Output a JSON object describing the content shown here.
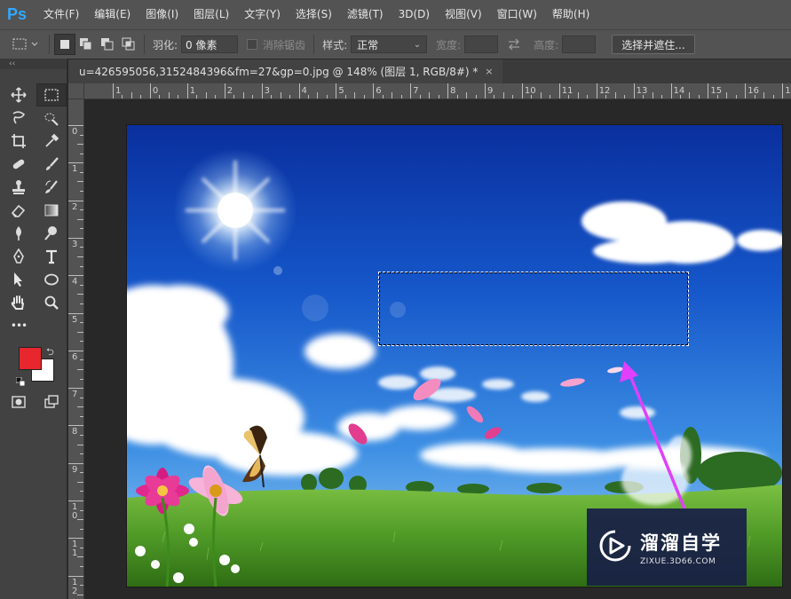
{
  "app": {
    "logo": "Ps"
  },
  "menu": [
    "文件(F)",
    "编辑(E)",
    "图像(I)",
    "图层(L)",
    "文字(Y)",
    "选择(S)",
    "滤镜(T)",
    "3D(D)",
    "视图(V)",
    "窗口(W)",
    "帮助(H)"
  ],
  "options": {
    "feather_label": "羽化:",
    "feather_value": "0 像素",
    "antialias_label": "消除锯齿",
    "style_label": "样式:",
    "style_value": "正常",
    "width_label": "宽度:",
    "height_label": "高度:",
    "select_mask_button": "选择并遮住..."
  },
  "toolbox": {
    "collapse": "‹‹",
    "more": "•••",
    "foreground_color": "#e8262e",
    "background_color": "#ffffff"
  },
  "document": {
    "tab_title": "u=426595056,3152484396&fm=27&gp=0.jpg @ 148% (图层 1, RGB/8#) *",
    "close": "×"
  },
  "rulers": {
    "horizontal": [
      "1",
      "0",
      "1",
      "2",
      "3",
      "4",
      "5",
      "6",
      "7",
      "8",
      "9",
      "10",
      "11",
      "12",
      "13",
      "14",
      "15",
      "16",
      "17"
    ],
    "vertical": [
      "0",
      "1",
      "2",
      "3",
      "4",
      "5",
      "6",
      "7",
      "8",
      "9",
      "1\n0",
      "1\n1",
      "1\n2"
    ]
  },
  "watermark": {
    "title": "溜溜自学",
    "url": "ZIXUE.3D66.COM"
  },
  "colors": {
    "accent": "#31a8ff",
    "arrow": "#e040fb"
  }
}
